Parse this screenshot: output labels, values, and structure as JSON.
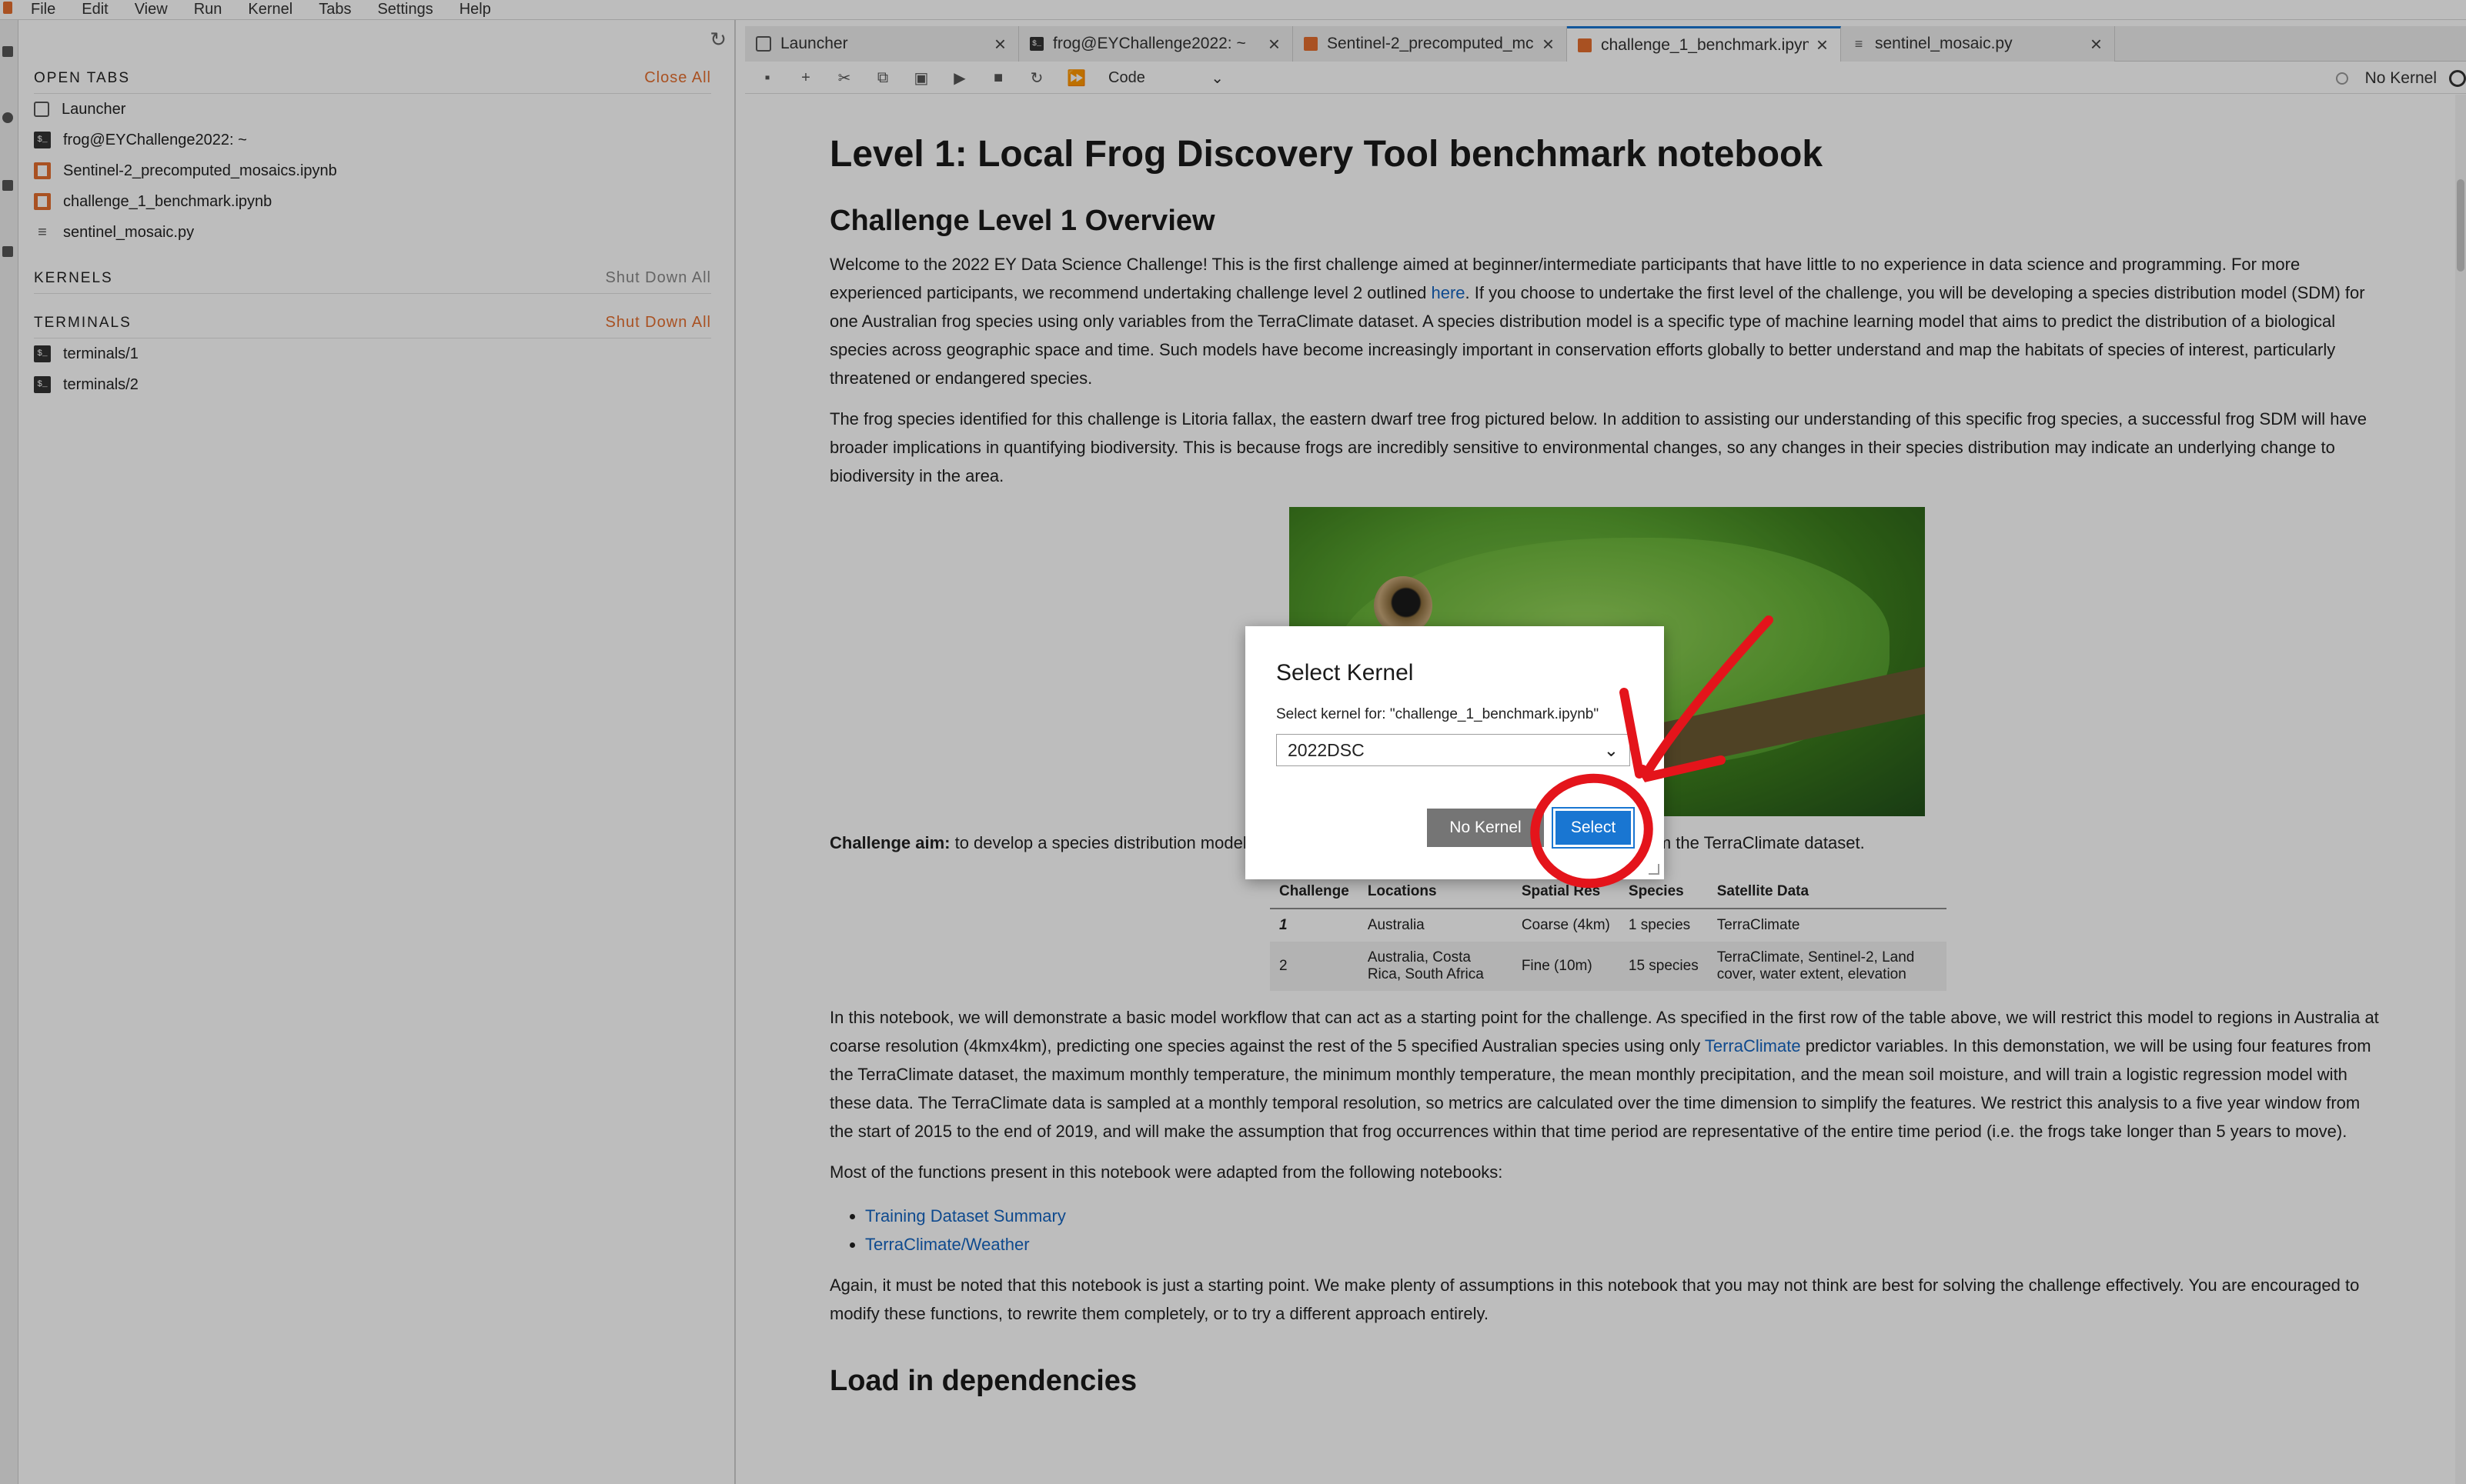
{
  "menu": [
    "File",
    "Edit",
    "View",
    "Run",
    "Kernel",
    "Tabs",
    "Settings",
    "Help"
  ],
  "sidebar": {
    "open_tabs": {
      "title": "OPEN TABS",
      "action": "Close All",
      "items": [
        {
          "label": "Launcher",
          "icon": "launcher-icon"
        },
        {
          "label": "frog@EYChallenge2022: ~",
          "icon": "terminal-icon"
        },
        {
          "label": "Sentinel-2_precomputed_mosaics.ipynb",
          "icon": "notebook-icon"
        },
        {
          "label": "challenge_1_benchmark.ipynb",
          "icon": "notebook-icon"
        },
        {
          "label": "sentinel_mosaic.py",
          "icon": "python-file-icon"
        }
      ]
    },
    "kernels": {
      "title": "KERNELS",
      "action": "Shut Down All"
    },
    "terminals": {
      "title": "TERMINALS",
      "action": "Shut Down All",
      "items": [
        {
          "label": "terminals/1",
          "icon": "terminal-icon"
        },
        {
          "label": "terminals/2",
          "icon": "terminal-icon"
        }
      ]
    }
  },
  "tabs": [
    {
      "label": "Launcher",
      "active": false
    },
    {
      "label": "frog@EYChallenge2022: ~",
      "active": false
    },
    {
      "label": "Sentinel-2_precomputed_mc",
      "active": false
    },
    {
      "label": "challenge_1_benchmark.ipyn",
      "active": true
    },
    {
      "label": "sentinel_mosaic.py",
      "active": false
    }
  ],
  "toolbar": {
    "cell_type": "Code",
    "kernel_status": "No Kernel"
  },
  "notebook": {
    "title": "Level 1: Local Frog Discovery Tool benchmark notebook",
    "overview_heading": "Challenge Level 1 Overview",
    "p1_before_link": "Welcome to the 2022 EY Data Science Challenge! This is the first challenge aimed at beginner/intermediate participants that have little to no experience in data science and programming. For more experienced participants, we recommend undertaking challenge level 2 outlined ",
    "p1_link": "here",
    "p1_after_link": ". If you choose to undertake the first level of the challenge, you will be developing a species distribution model (SDM) for one Australian frog species using only variables from the TerraClimate dataset. A species distribution model is a specific type of machine learning model that aims to predict the distribution of a biological species across geographic space and time. Such models have become increasingly important in conservation efforts globally to better understand and map the habitats of species of interest, particularly threatened or endangered species.",
    "p2": "The frog species identified for this challenge is Litoria fallax, the eastern dwarf tree frog pictured below. In addition to assisting our understanding of this specific frog species, a successful frog SDM will have broader implications in quantifying biodiversity. This is because frogs are incredibly sensitive to environmental changes, so any changes in their species distribution may indicate an underlying change to biodiversity in the area.",
    "aim_label": "Challenge aim:",
    "aim_text": " to develop a species distribution model for litoria fallax across Australia using weather data from the TerraClimate dataset.",
    "table": {
      "headers": [
        "Challenge",
        "Locations",
        "Spatial Res",
        "Species",
        "Satellite Data"
      ],
      "rows": [
        [
          "1",
          "Australia",
          "Coarse (4km)",
          "1 species",
          "TerraClimate"
        ],
        [
          "2",
          "Australia, Costa Rica, South Africa",
          "Fine (10m)",
          "15 species",
          "TerraClimate, Sentinel-2, Land cover, water extent, elevation"
        ]
      ]
    },
    "p3_before_link": "In this notebook, we will demonstrate a basic model workflow that can act as a starting point for the challenge. As specified in the first row of the table above, we will restrict this model to regions in Australia at coarse resolution (4kmx4km), predicting one species against the rest of the 5 specified Australian species using only ",
    "p3_link": "TerraClimate",
    "p3_after_link": " predictor variables. In this demonstation, we will be using four features from the TerraClimate dataset, the maximum monthly temperature, the minimum monthly temperature, the mean monthly precipitation, and the mean soil moisture, and will train a logistic regression model with these data. The TerraClimate data is sampled at a monthly temporal resolution, so metrics are calculated over the time dimension to simplify the features. We restrict this analysis to a five year window from the start of 2015 to the end of 2019, and will make the assumption that frog occurrences within that time period are representative of the entire time period (i.e. the frogs take longer than 5 years to move).",
    "p4": "Most of the functions present in this notebook were adapted from the following notebooks:",
    "links": [
      "Training Dataset Summary",
      "TerraClimate/Weather"
    ],
    "p5": "Again, it must be noted that this notebook is just a starting point. We make plenty of assumptions in this notebook that you may not think are best for solving the challenge effectively. You are encouraged to modify these functions, to rewrite them completely, or to try a different approach entirely.",
    "next_heading": "Load in dependencies"
  },
  "dialog": {
    "title": "Select Kernel",
    "subtitle": "Select kernel for: \"challenge_1_benchmark.ipynb\"",
    "selected_kernel": "2022DSC",
    "no_kernel_label": "No Kernel",
    "select_label": "Select"
  },
  "colors": {
    "accent_orange": "#e46e2e",
    "primary_blue": "#1976d2",
    "annotation_red": "#e4141b"
  }
}
